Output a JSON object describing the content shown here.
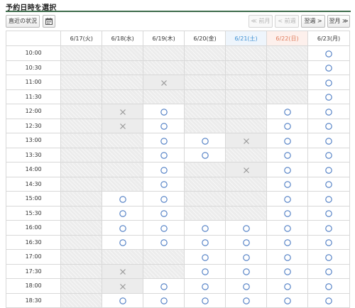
{
  "page": {
    "title": "予約日時を選択"
  },
  "toolbar": {
    "status_label": "直近の状況",
    "calendar_icon": "calendar-icon",
    "prev_month_label": "≪ 前月",
    "prev_week_label": "< 前週",
    "next_week_label": "翌週 >",
    "next_month_label": "翌月 ≫"
  },
  "colors": {
    "accent_rule": "#3d6b4a",
    "saturday": "#3c8fd3",
    "sunday": "#e07b5a",
    "available_mark": "#4a7ac2",
    "full_mark": "#9a9a9a",
    "closed_cell": "#ececec"
  },
  "legend_meaning": {
    "o": "available",
    "x": "full",
    "-": "closed"
  },
  "schedule": {
    "days": [
      {
        "label": "6/17(火)",
        "weekday": "weekday"
      },
      {
        "label": "6/18(水)",
        "weekday": "weekday"
      },
      {
        "label": "6/19(木)",
        "weekday": "weekday"
      },
      {
        "label": "6/20(金)",
        "weekday": "weekday"
      },
      {
        "label": "6/21(土)",
        "weekday": "sat"
      },
      {
        "label": "6/22(日)",
        "weekday": "sun"
      },
      {
        "label": "6/23(月)",
        "weekday": "weekday"
      }
    ],
    "rows": [
      {
        "time": "10:00",
        "slots": [
          "-",
          "-",
          "-",
          "-",
          "-",
          "-",
          "o"
        ]
      },
      {
        "time": "10:30",
        "slots": [
          "-",
          "-",
          "-",
          "-",
          "-",
          "-",
          "o"
        ]
      },
      {
        "time": "11:00",
        "slots": [
          "-",
          "-",
          "x",
          "-",
          "-",
          "-",
          "o"
        ]
      },
      {
        "time": "11:30",
        "slots": [
          "-",
          "-",
          "-",
          "-",
          "-",
          "-",
          "o"
        ]
      },
      {
        "time": "12:00",
        "slots": [
          "-",
          "x",
          "o",
          "-",
          "-",
          "o",
          "o"
        ]
      },
      {
        "time": "12:30",
        "slots": [
          "-",
          "x",
          "o",
          "-",
          "-",
          "o",
          "o"
        ]
      },
      {
        "time": "13:00",
        "slots": [
          "-",
          "-",
          "o",
          "o",
          "x",
          "o",
          "o"
        ]
      },
      {
        "time": "13:30",
        "slots": [
          "-",
          "-",
          "o",
          "o",
          "-",
          "o",
          "o"
        ]
      },
      {
        "time": "14:00",
        "slots": [
          "-",
          "-",
          "o",
          "-",
          "x",
          "o",
          "o"
        ]
      },
      {
        "time": "14:30",
        "slots": [
          "-",
          "-",
          "o",
          "-",
          "-",
          "o",
          "o"
        ]
      },
      {
        "time": "15:00",
        "slots": [
          "-",
          "o",
          "o",
          "-",
          "-",
          "o",
          "o"
        ]
      },
      {
        "time": "15:30",
        "slots": [
          "-",
          "o",
          "o",
          "-",
          "-",
          "o",
          "o"
        ]
      },
      {
        "time": "16:00",
        "slots": [
          "-",
          "o",
          "o",
          "o",
          "o",
          "o",
          "o"
        ]
      },
      {
        "time": "16:30",
        "slots": [
          "-",
          "o",
          "o",
          "o",
          "o",
          "o",
          "o"
        ]
      },
      {
        "time": "17:00",
        "slots": [
          "-",
          "-",
          "-",
          "o",
          "o",
          "o",
          "o"
        ]
      },
      {
        "time": "17:30",
        "slots": [
          "-",
          "x",
          "-",
          "o",
          "o",
          "o",
          "o"
        ]
      },
      {
        "time": "18:00",
        "slots": [
          "-",
          "x",
          "o",
          "o",
          "o",
          "o",
          "o"
        ]
      },
      {
        "time": "18:30",
        "slots": [
          "-",
          "o",
          "o",
          "o",
          "o",
          "o",
          "o"
        ]
      }
    ]
  }
}
